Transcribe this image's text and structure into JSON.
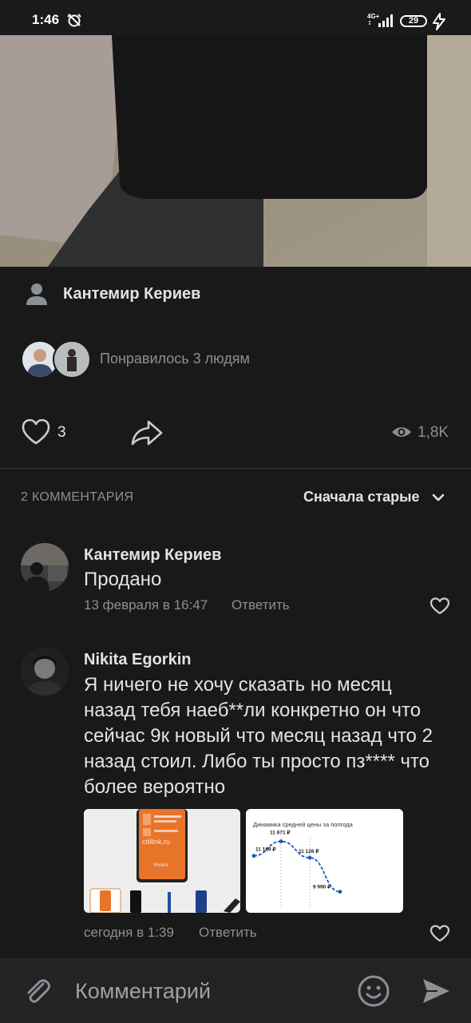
{
  "status_bar": {
    "time": "1:46",
    "network": "4G+",
    "battery": "29"
  },
  "post": {
    "author": "Кантемир Кериев",
    "likes_text": "Понравилось 3 людям",
    "like_count": "3",
    "views": "1,8K"
  },
  "comments_header": {
    "count_label": "2 КОММЕНТАРИЯ",
    "sort_label": "Сначала старые"
  },
  "comments": [
    {
      "author": "Кантемир Кериев",
      "text": "Продано",
      "date": "13 февраля в 16:47",
      "reply_label": "Ответить"
    },
    {
      "author": "Nikita Egorkin",
      "text_lines": [
        "Я ничего не хочу сказать но месяц",
        "назад тебя наеб**ли конкретно он что",
        "сейчас 9к новый что месяц назад что 2",
        "назад стоил. Либо ты просто пз**** что",
        "более вероятно"
      ],
      "date": "сегодня в 1:39",
      "reply_label": "Ответить",
      "attachments": {
        "phone_image": {
          "site_watermark": "citilink.ru",
          "brand": "Redmi"
        },
        "price_chart": {
          "title": "Динамика средней цены за полгода",
          "labels": [
            "11 189 ₽",
            "11 671 ₽",
            "11 126 ₽",
            "9 990 ₽"
          ]
        }
      }
    }
  ],
  "input": {
    "placeholder": "Комментарий"
  },
  "chart_data": {
    "type": "line",
    "title": "Динамика средней цены за полгода",
    "values": [
      11189,
      11671,
      11126,
      9990
    ],
    "ylabel": "₽"
  }
}
